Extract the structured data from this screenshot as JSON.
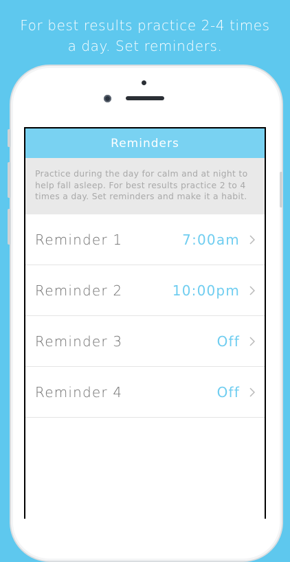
{
  "promo": {
    "line1": "For best results practice 2-4 times",
    "line2": "a day. Set reminders."
  },
  "screen": {
    "title": "Reminders",
    "info_text": "Practice during the day for calm and at night to help fall asleep. For best results practice 2 to 4 times a day. Set reminders and make it a habit.",
    "reminders": [
      {
        "label": "Reminder 1",
        "value": "7:00am"
      },
      {
        "label": "Reminder 2",
        "value": "10:00pm"
      },
      {
        "label": "Reminder 3",
        "value": "Off"
      },
      {
        "label": "Reminder 4",
        "value": "Off"
      }
    ]
  },
  "colors": {
    "background": "#5ec8ee",
    "navbar": "#79d2f2",
    "accent_value": "#6fcdf0",
    "info_bg": "#e9e9e9"
  },
  "icons": {
    "row_chevron": "chevron-right-icon"
  }
}
